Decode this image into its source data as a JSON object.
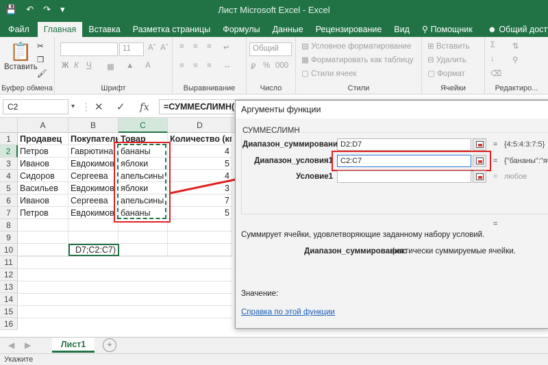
{
  "window": {
    "title": "Лист Microsoft Excel - Excel"
  },
  "ribbon_tabs": [
    "Файл",
    "Главная",
    "Вставка",
    "Разметка страницы",
    "Формулы",
    "Данные",
    "Рецензирование",
    "Вид",
    "Помощник",
    "Общий доступ"
  ],
  "ribbon": {
    "clipboard": {
      "paste": "Вставить",
      "label": "Буфер обмена"
    },
    "font": {
      "name": "",
      "size": "11",
      "label": "Шрифт"
    },
    "alignment": {
      "label": "Выравнивание"
    },
    "number": {
      "format": "Общий",
      "label": "Число"
    },
    "styles": {
      "cond": "Условное форматирование",
      "table": "Форматировать как таблицу",
      "cell": "Стили ячеек",
      "label": "Стили"
    },
    "cells": {
      "insert": "Вставить",
      "delete": "Удалить",
      "format": "Формат",
      "label": "Ячейки"
    },
    "editing": {
      "label": "Редактиро..."
    }
  },
  "formula_bar": {
    "name_box": "C2",
    "formula": "=СУММЕСЛИМН("
  },
  "columns": [
    "A",
    "B",
    "C",
    "D"
  ],
  "rows": [
    "1",
    "2",
    "3",
    "4",
    "5",
    "6",
    "7",
    "8",
    "9",
    "10",
    "11",
    "12",
    "13",
    "14",
    "15",
    "16"
  ],
  "table": {
    "headers": [
      "Продавец",
      "Покупатель",
      "Товар",
      "Количество (кг)"
    ],
    "rows": [
      [
        "Петров",
        "Гаврютина",
        "бананы",
        "4"
      ],
      [
        "Иванов",
        "Евдокимов",
        "яблоки",
        "5"
      ],
      [
        "Сидоров",
        "Сергеева",
        "апельсины",
        "4"
      ],
      [
        "Васильев",
        "Евдокимов",
        "яблоки",
        "3"
      ],
      [
        "Иванов",
        "Сергеева",
        "апельсины",
        "7"
      ],
      [
        "Петров",
        "Евдокимов",
        "бананы",
        "5"
      ]
    ]
  },
  "active_cell": {
    "text": "D7;C2:C7)"
  },
  "sheet": {
    "tab": "Лист1",
    "status": "Укажите"
  },
  "dialog": {
    "title": "Аргументы функции",
    "function": "СУММЕСЛИМН",
    "args": [
      {
        "label": "Диапазон_суммирования",
        "value": "D2:D7",
        "result": "{4:5:4:3:7:5}"
      },
      {
        "label": "Диапазон_условия1",
        "value": "C2:C7",
        "result": "{\"бананы\":\"ябл"
      },
      {
        "label": "Условие1",
        "value": "",
        "result": "любое"
      }
    ],
    "description": "Суммирует ячейки, удовлетворяющие заданному набору условий.",
    "param_name": "Диапазон_суммирования:",
    "param_desc": "фактически суммируемые ячейки.",
    "value_label": "Значение:",
    "help_link": "Справка по этой функции"
  },
  "colors": {
    "excel_green": "#217346",
    "highlight_red": "#e02020",
    "marquee": "#217346"
  }
}
